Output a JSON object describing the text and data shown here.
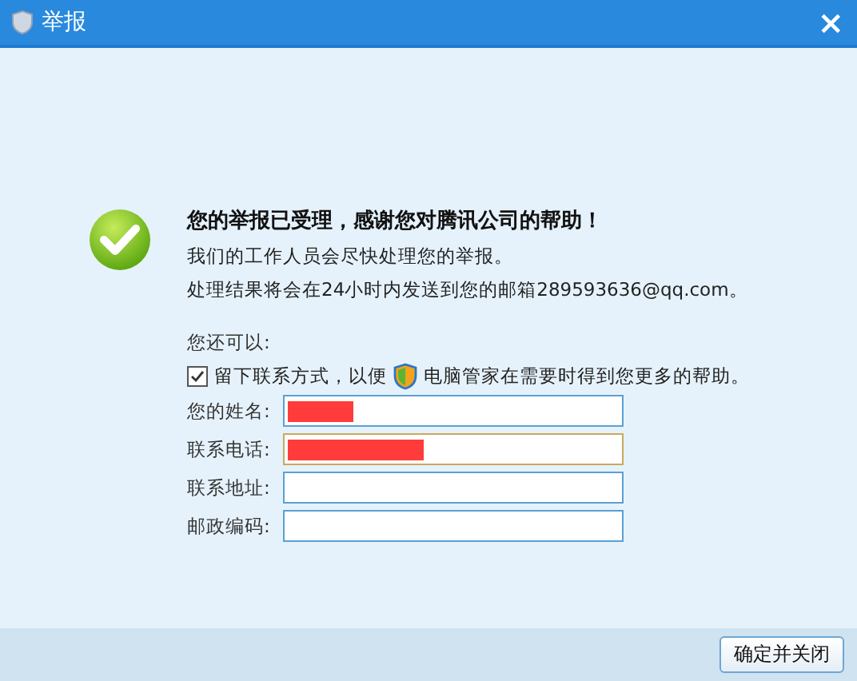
{
  "window": {
    "title": "举报",
    "close": "×"
  },
  "message": {
    "heading": "您的举报已受理，感谢您对腾讯公司的帮助！",
    "lines": [
      "我们的工作人员会尽快处理您的举报。",
      "处理结果将会在24小时内发送到您的邮箱289593636@qq.com。"
    ]
  },
  "options": {
    "intro": "您还可以:",
    "consent": {
      "checked": true,
      "before": "留下联系方式，以便",
      "after": "电脑管家在需要时得到您更多的帮助。"
    }
  },
  "fields": [
    {
      "label": "您的姓名:",
      "focused": false,
      "level": 0.2
    },
    {
      "label": "联系电话:",
      "focused": true,
      "level": 0.41
    },
    {
      "label": "联系地址:",
      "focused": false
    },
    {
      "label": "邮政编码:",
      "focused": false
    }
  ],
  "buttons": [
    "确定并关闭"
  ]
}
